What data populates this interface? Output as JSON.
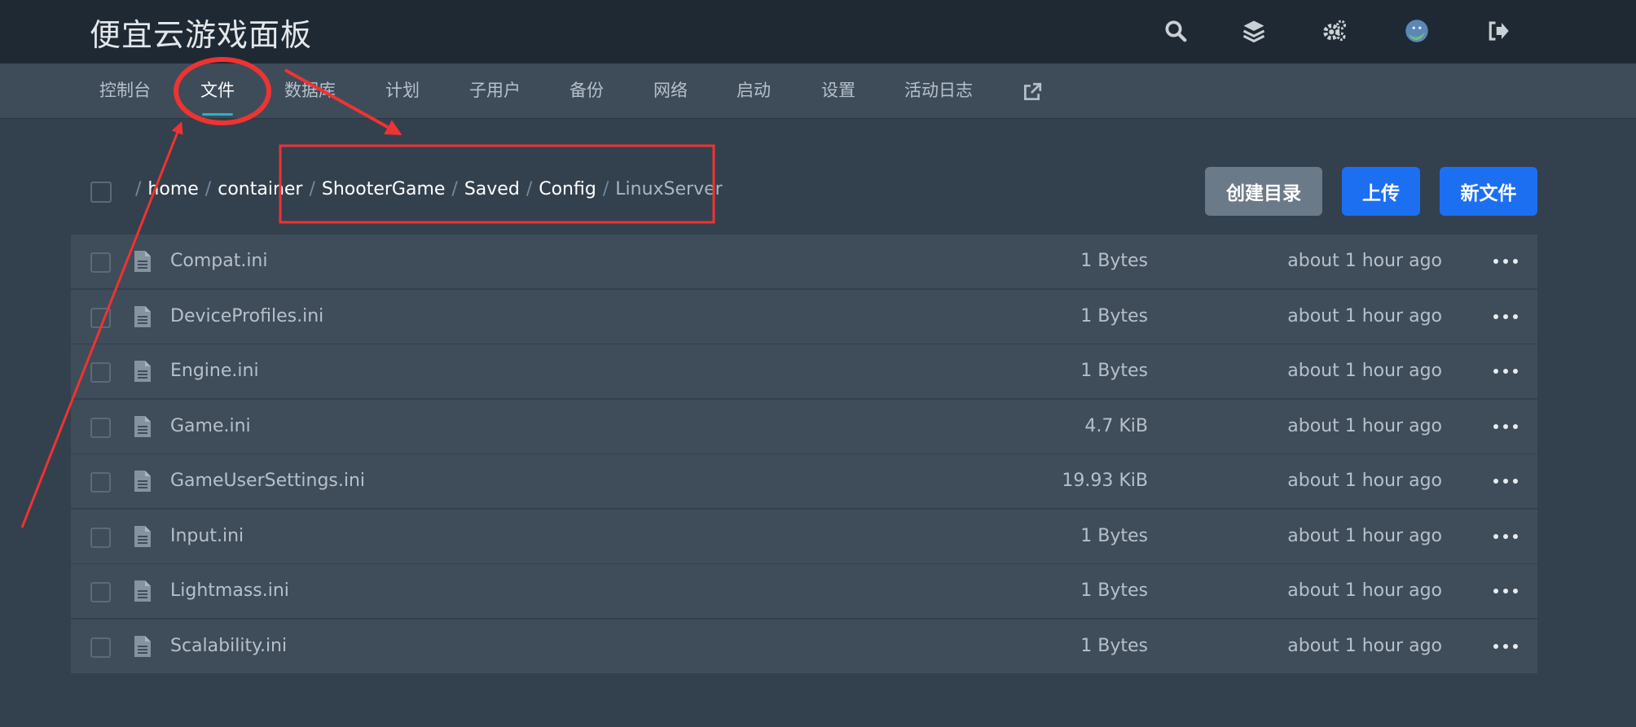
{
  "app": {
    "title": "便宜云游戏面板"
  },
  "topbar": {
    "icons": [
      "search-icon",
      "layers-icon",
      "settings-icon",
      "avatar",
      "logout-icon"
    ]
  },
  "nav": {
    "items": [
      {
        "label": "控制台"
      },
      {
        "label": "文件",
        "active": true
      },
      {
        "label": "数据库"
      },
      {
        "label": "计划"
      },
      {
        "label": "子用户"
      },
      {
        "label": "备份"
      },
      {
        "label": "网络"
      },
      {
        "label": "启动"
      },
      {
        "label": "设置"
      },
      {
        "label": "活动日志"
      }
    ],
    "external_icon": "external-link-icon"
  },
  "breadcrumb": {
    "separator": "/",
    "segments": [
      "home",
      "container",
      "ShooterGame",
      "Saved",
      "Config",
      "LinuxServer"
    ]
  },
  "actions": {
    "mkdir": "创建目录",
    "upload": "上传",
    "new_file": "新文件"
  },
  "files": [
    {
      "name": "Compat.ini",
      "size": "1 Bytes",
      "modified": "about 1 hour ago"
    },
    {
      "name": "DeviceProfiles.ini",
      "size": "1 Bytes",
      "modified": "about 1 hour ago"
    },
    {
      "name": "Engine.ini",
      "size": "1 Bytes",
      "modified": "about 1 hour ago"
    },
    {
      "name": "Game.ini",
      "size": "4.7 KiB",
      "modified": "about 1 hour ago"
    },
    {
      "name": "GameUserSettings.ini",
      "size": "19.93 KiB",
      "modified": "about 1 hour ago"
    },
    {
      "name": "Input.ini",
      "size": "1 Bytes",
      "modified": "about 1 hour ago"
    },
    {
      "name": "Lightmass.ini",
      "size": "1 Bytes",
      "modified": "about 1 hour ago"
    },
    {
      "name": "Scalability.ini",
      "size": "1 Bytes",
      "modified": "about 1 hour ago"
    }
  ],
  "colors": {
    "topbar": "#1f2933",
    "subnav": "#3e4c5a",
    "page": "#33404d",
    "row": "#3f4c59",
    "primary": "#1d6ff2",
    "secondary": "#6b7a89",
    "active_underline": "#2bb3c0",
    "annotation": "#ee3333"
  }
}
